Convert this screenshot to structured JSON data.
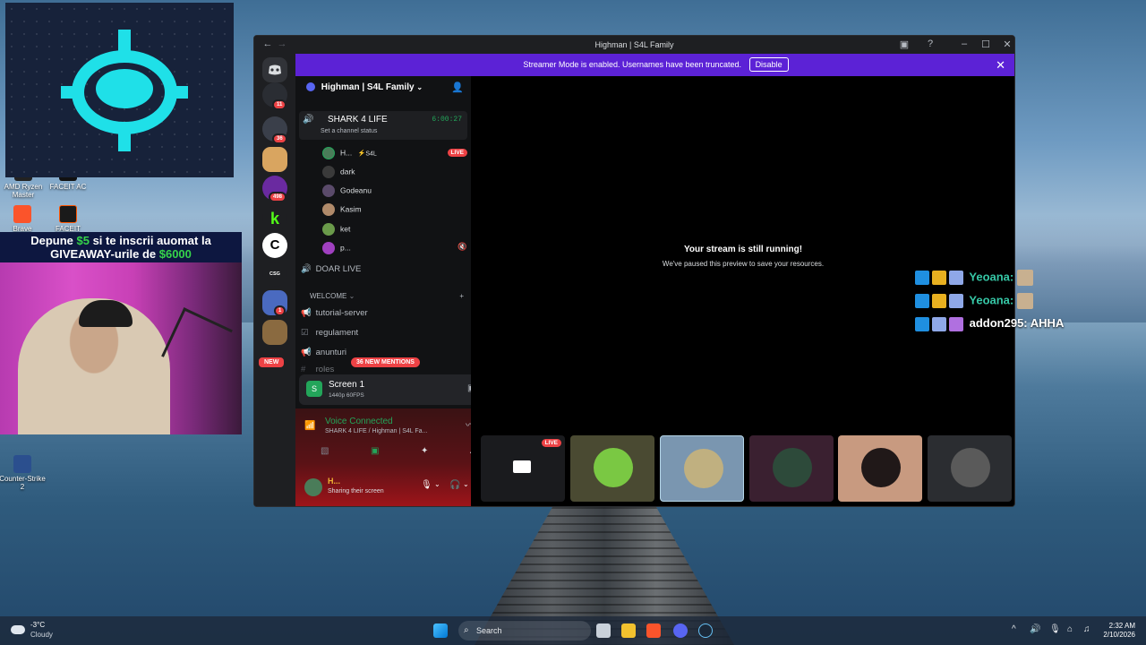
{
  "desktop": {
    "icons": [
      {
        "label": "AMD Ryzen Master",
        "color": "#222"
      },
      {
        "label": "FACEIT AC",
        "color": "#111"
      },
      {
        "label": "Brave",
        "color": "#fb542b"
      },
      {
        "label": "FACEIT",
        "color": "#ff5500"
      },
      {
        "label": "Counter-Strike 2",
        "color": "#2b4f8e"
      }
    ]
  },
  "overlay": {
    "banner_line1_pre": "Depune ",
    "banner_amount1": "$5",
    "banner_line1_post": " si te inscrii auomat la",
    "banner_line2_pre": "GIVEAWAY-urile de ",
    "banner_amount2": "$6000"
  },
  "window": {
    "title": "Highman | S4L Family",
    "streamer_text": "Streamer Mode is enabled. Usernames have been truncated.",
    "disable_label": "Disable"
  },
  "server_badges": [
    "11",
    "36",
    "498",
    "1"
  ],
  "server_labels": {
    "csg": "CSG SKINS",
    "new": "NEW"
  },
  "sidebar": {
    "server_name": "Highman | S4L Family",
    "voice_channel": {
      "name": "SHARK 4 LIFE",
      "timer": "6:00:27",
      "status": "Set a channel status"
    },
    "voice_users": [
      {
        "name": "H...",
        "tag": "S4L",
        "live": "LIVE",
        "color": "#4a7c59"
      },
      {
        "name": "dark",
        "color": "#3a3a3a"
      },
      {
        "name": "Godeanu",
        "color": "#5a4a6a"
      },
      {
        "name": "Kasim",
        "color": "#b08a6a"
      },
      {
        "name": "ket",
        "color": "#6a9a4a"
      },
      {
        "name": "p...",
        "color": "#a040c0"
      }
    ],
    "channels": [
      {
        "name": "DOAR LIVE",
        "sym": "🔊"
      },
      {
        "name": "WELCOME",
        "sym": "⌄",
        "category": true
      },
      {
        "name": "tutorial-server",
        "sym": "📢"
      },
      {
        "name": "regulament",
        "sym": "☑"
      },
      {
        "name": "anunturi",
        "sym": "📢"
      },
      {
        "name": "roles",
        "sym": "#"
      }
    ],
    "mentions": "36 NEW MENTIONS"
  },
  "screen_panel": {
    "title": "Screen 1",
    "sub": "1440p 60FPS"
  },
  "voice_panel": {
    "status": "Voice Connected",
    "location": "SHARK 4 LIFE / Highman | S4L Fa..."
  },
  "user_panel": {
    "name": "H...",
    "status": "Sharing their screen"
  },
  "main": {
    "headline": "Your stream is still running!",
    "subline": "We've paused this preview to save your resources.",
    "tiles": [
      {
        "live": "LIVE",
        "bg": "#1a1b1e"
      },
      {
        "bg": "#4a4a32",
        "av": "#7ac843"
      },
      {
        "bg": "#7a96b0",
        "av": "#c0b080"
      },
      {
        "bg": "#3a2030",
        "av": "#2d4a3a"
      },
      {
        "bg": "#c89a80",
        "av": "#201818"
      },
      {
        "bg": "#2b2d31",
        "av": "#5a5a5a"
      }
    ]
  },
  "chat": [
    {
      "user": "Yeoana:",
      "msg": "",
      "color": "#36c7a6"
    },
    {
      "user": "Yeoana:",
      "msg": "",
      "color": "#36c7a6"
    },
    {
      "user": "addon295:",
      "msg": "AHHA",
      "color": "#ffffff"
    }
  ],
  "taskbar": {
    "weather_temp": "-3°C",
    "weather_desc": "Cloudy",
    "search": "Search",
    "time": "2:32 AM",
    "date": "2/10/2026"
  }
}
